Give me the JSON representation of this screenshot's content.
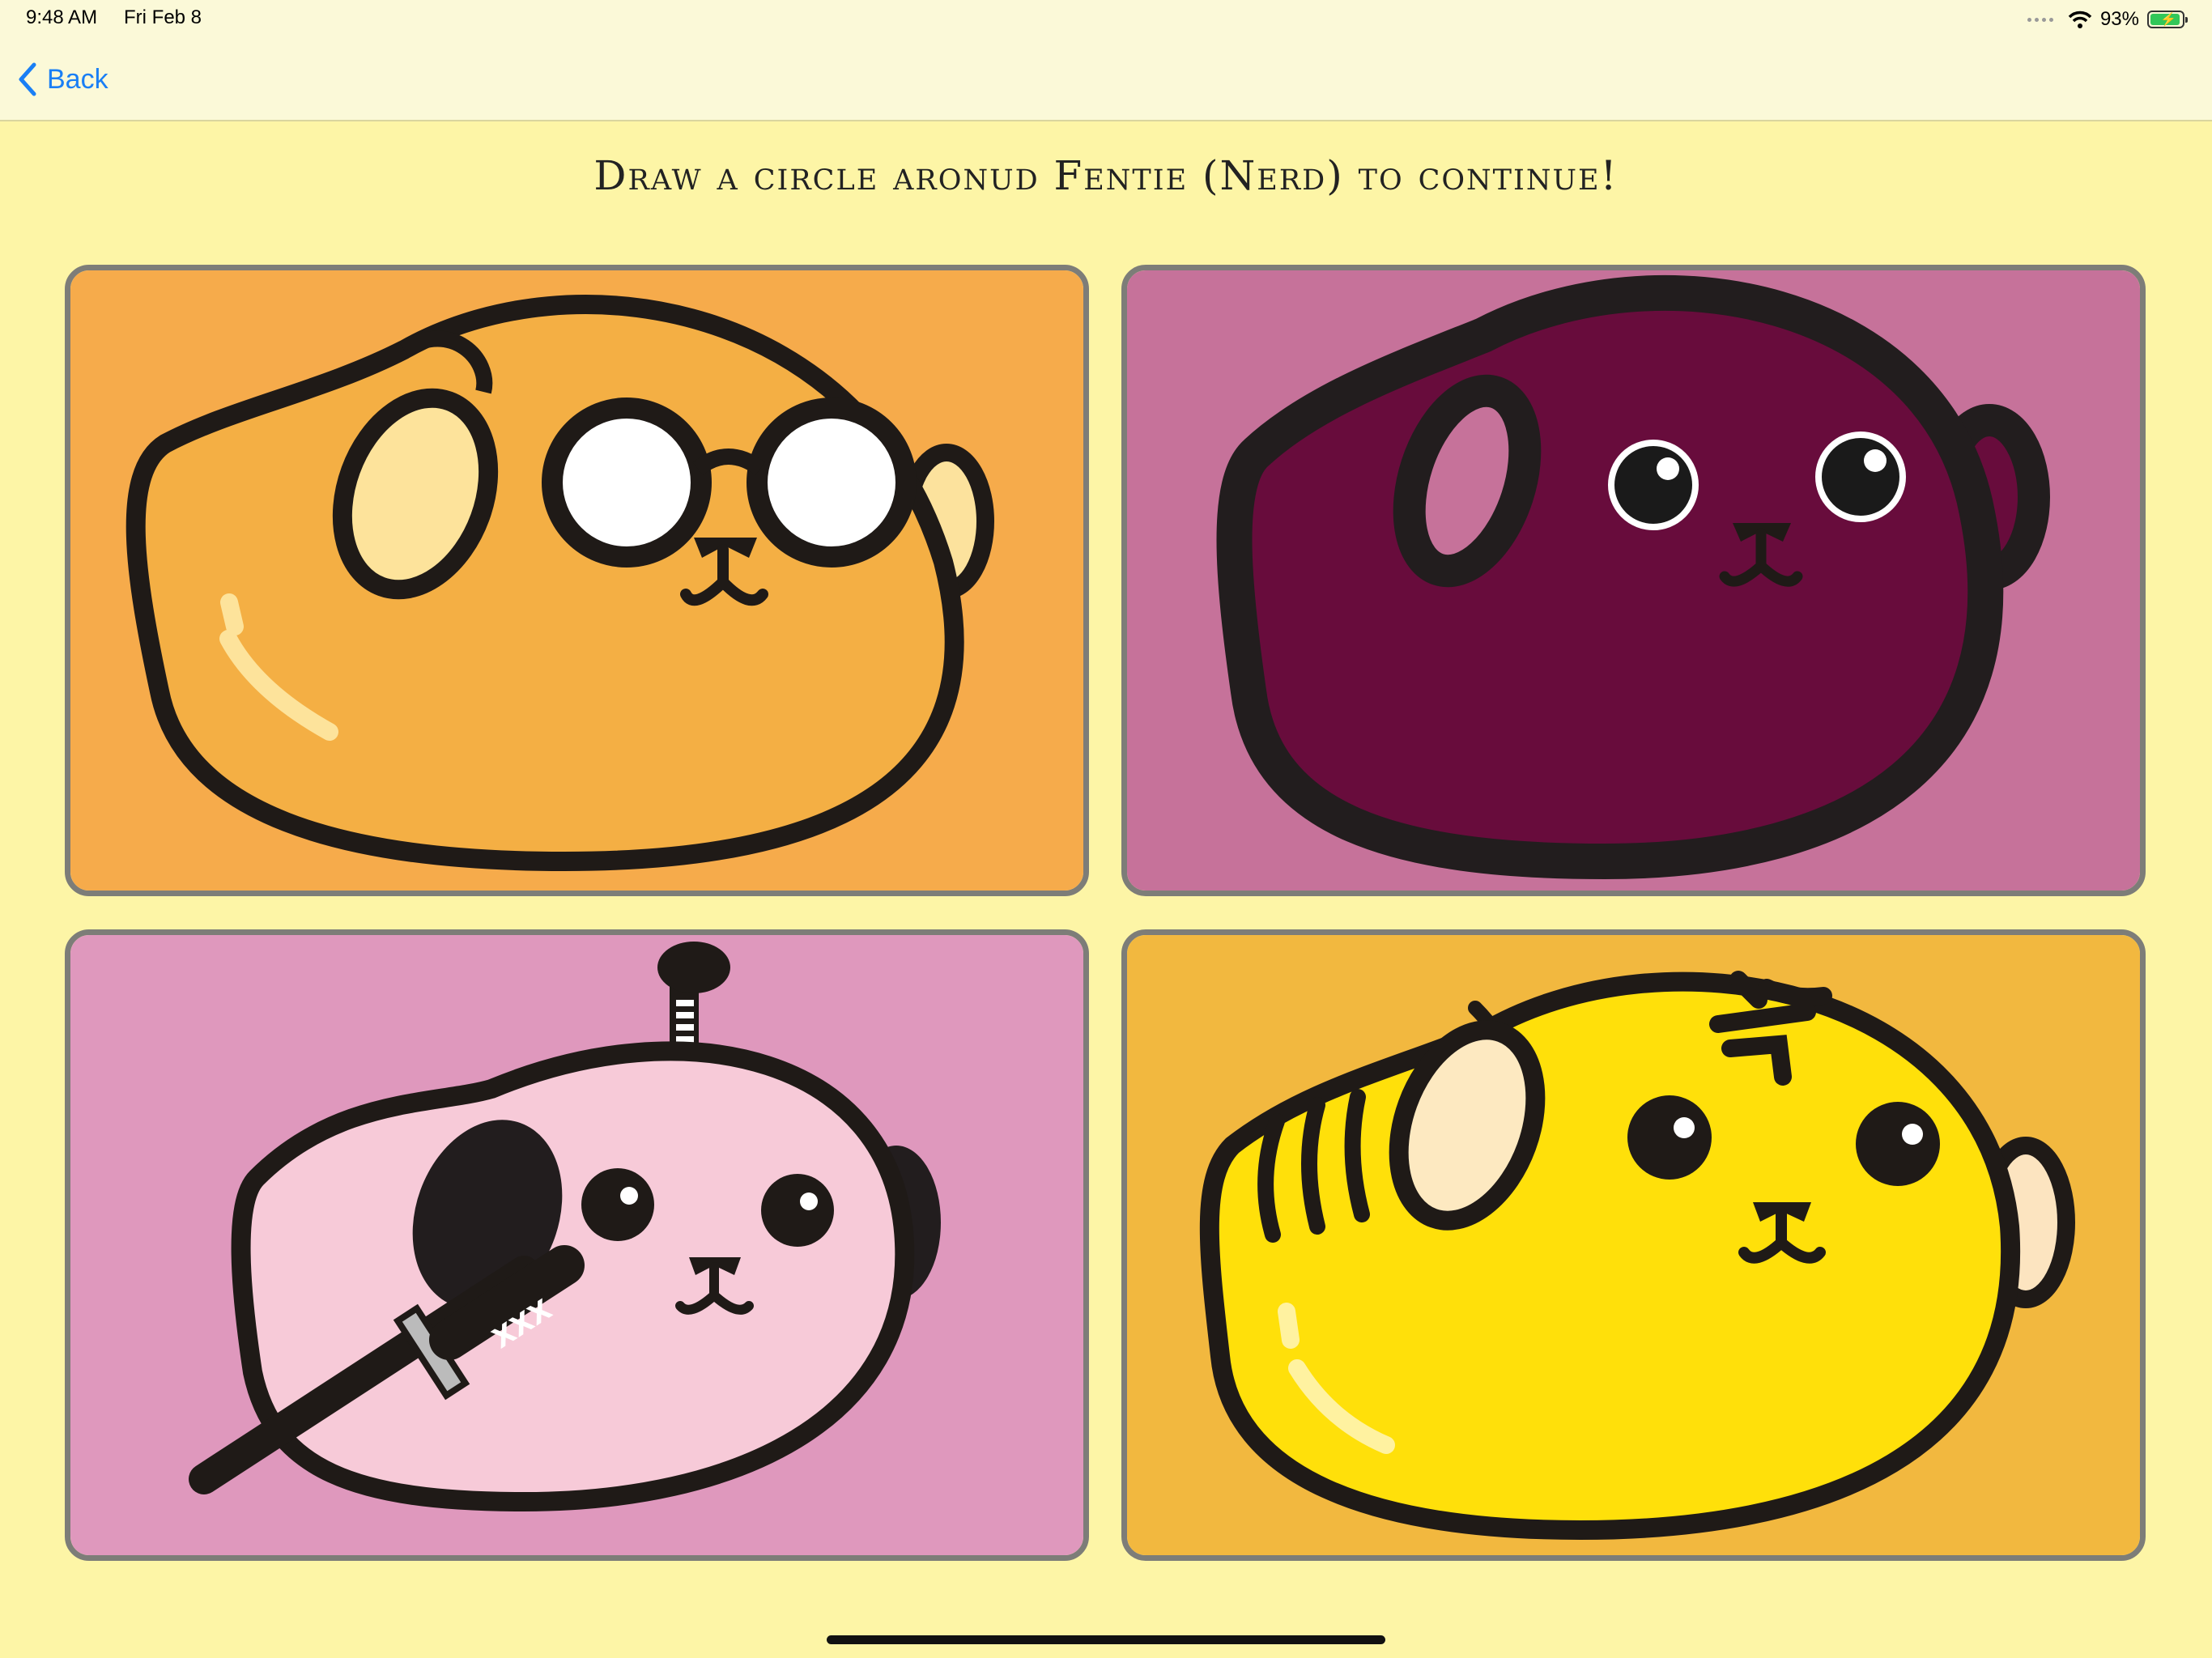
{
  "status_bar": {
    "time": "9:48 AM",
    "date": "Fri Feb 8",
    "battery": "93%",
    "icons": [
      "cellular-dots-icon",
      "wifi-icon",
      "battery-charging-icon"
    ]
  },
  "nav": {
    "back_label": "Back",
    "back_icon": "chevron-left-icon"
  },
  "instruction": "Draw a circle aronud Fentie (Nerd) to continue!",
  "tiles": [
    {
      "character": "orange-nerd-glasses",
      "background": "#f6ab4b",
      "body": "#f4af44"
    },
    {
      "character": "purple-dark",
      "background": "#c6729a",
      "body": "#680c3c"
    },
    {
      "character": "pink-pirate-sword",
      "background": "#df98bd",
      "body": "#f7cad8"
    },
    {
      "character": "yellow-tiger",
      "background": "#f2b83f",
      "body": "#ffe00a"
    }
  ],
  "colors": {
    "accent": "#1a7ff5",
    "page_background": "#fdf5a6",
    "tile_border": "#7d7d78"
  }
}
